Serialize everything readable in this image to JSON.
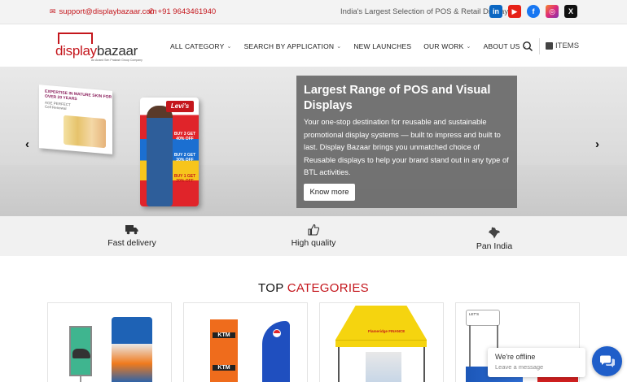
{
  "topbar": {
    "email": "support@displaybazaar.com",
    "phone": "+91 9643461940",
    "tagline": "India's Largest Selection of POS & Retail Display",
    "social": [
      "linkedin",
      "youtube",
      "facebook",
      "instagram",
      "x"
    ]
  },
  "header": {
    "logo_part1": "display",
    "logo_part2": "bazaar",
    "logo_tagline": "An Anand Sen Prakash Group Company",
    "nav": [
      "ALL CATEGORY",
      "SEARCH BY APPLICATION",
      "NEW LAUNCHES",
      "OUR WORK",
      "ABOUT US"
    ],
    "cart_label": "ITEMS"
  },
  "hero": {
    "title": "Largest Range of POS and Visual Displays",
    "text": "Your one-stop destination for reusable and sustainable promotional display systems — built to impress and built to last. Display Bazaar brings you unmatched choice of Reusable displays to help your brand stand out in any type of BTL activities.",
    "button": "Know more",
    "prev": "‹",
    "next": "›",
    "slide_panel": {
      "headline": "EXPERTISE IN MATURE SKIN FOR OVER 20 YEARS",
      "sub": "AGE PERFECT",
      "sub2": "Cell Renewal"
    },
    "slide_standee": {
      "brand": "Levi's",
      "offer1": "BUY 3 GET 40% OFF",
      "offer2": "BUY 2 GET 30% OFF",
      "offer3": "BUY 1 GET 20% OFF"
    }
  },
  "features": [
    {
      "label": "Fast delivery",
      "icon": "truck-icon"
    },
    {
      "label": "High quality",
      "icon": "thumbs-up-icon"
    },
    {
      "label": "Pan India",
      "icon": "india-map-icon"
    }
  ],
  "categories": {
    "title_part1": "TOP",
    "title_part2": "CATEGORIES",
    "card1": {
      "sign1": "FAST & FASHION",
      "brand": "Gillette"
    },
    "card2": {
      "flag1": "KTM",
      "flag2": "PEPSI"
    },
    "card3": {
      "brand": "Flameridge FINANCE"
    },
    "card4": {
      "board": "LET'S"
    }
  },
  "chat": {
    "status": "We're offline",
    "message": "Leave a message"
  },
  "colors": {
    "brand_red": "#c4161c",
    "chat_blue": "#1f5ec9"
  }
}
